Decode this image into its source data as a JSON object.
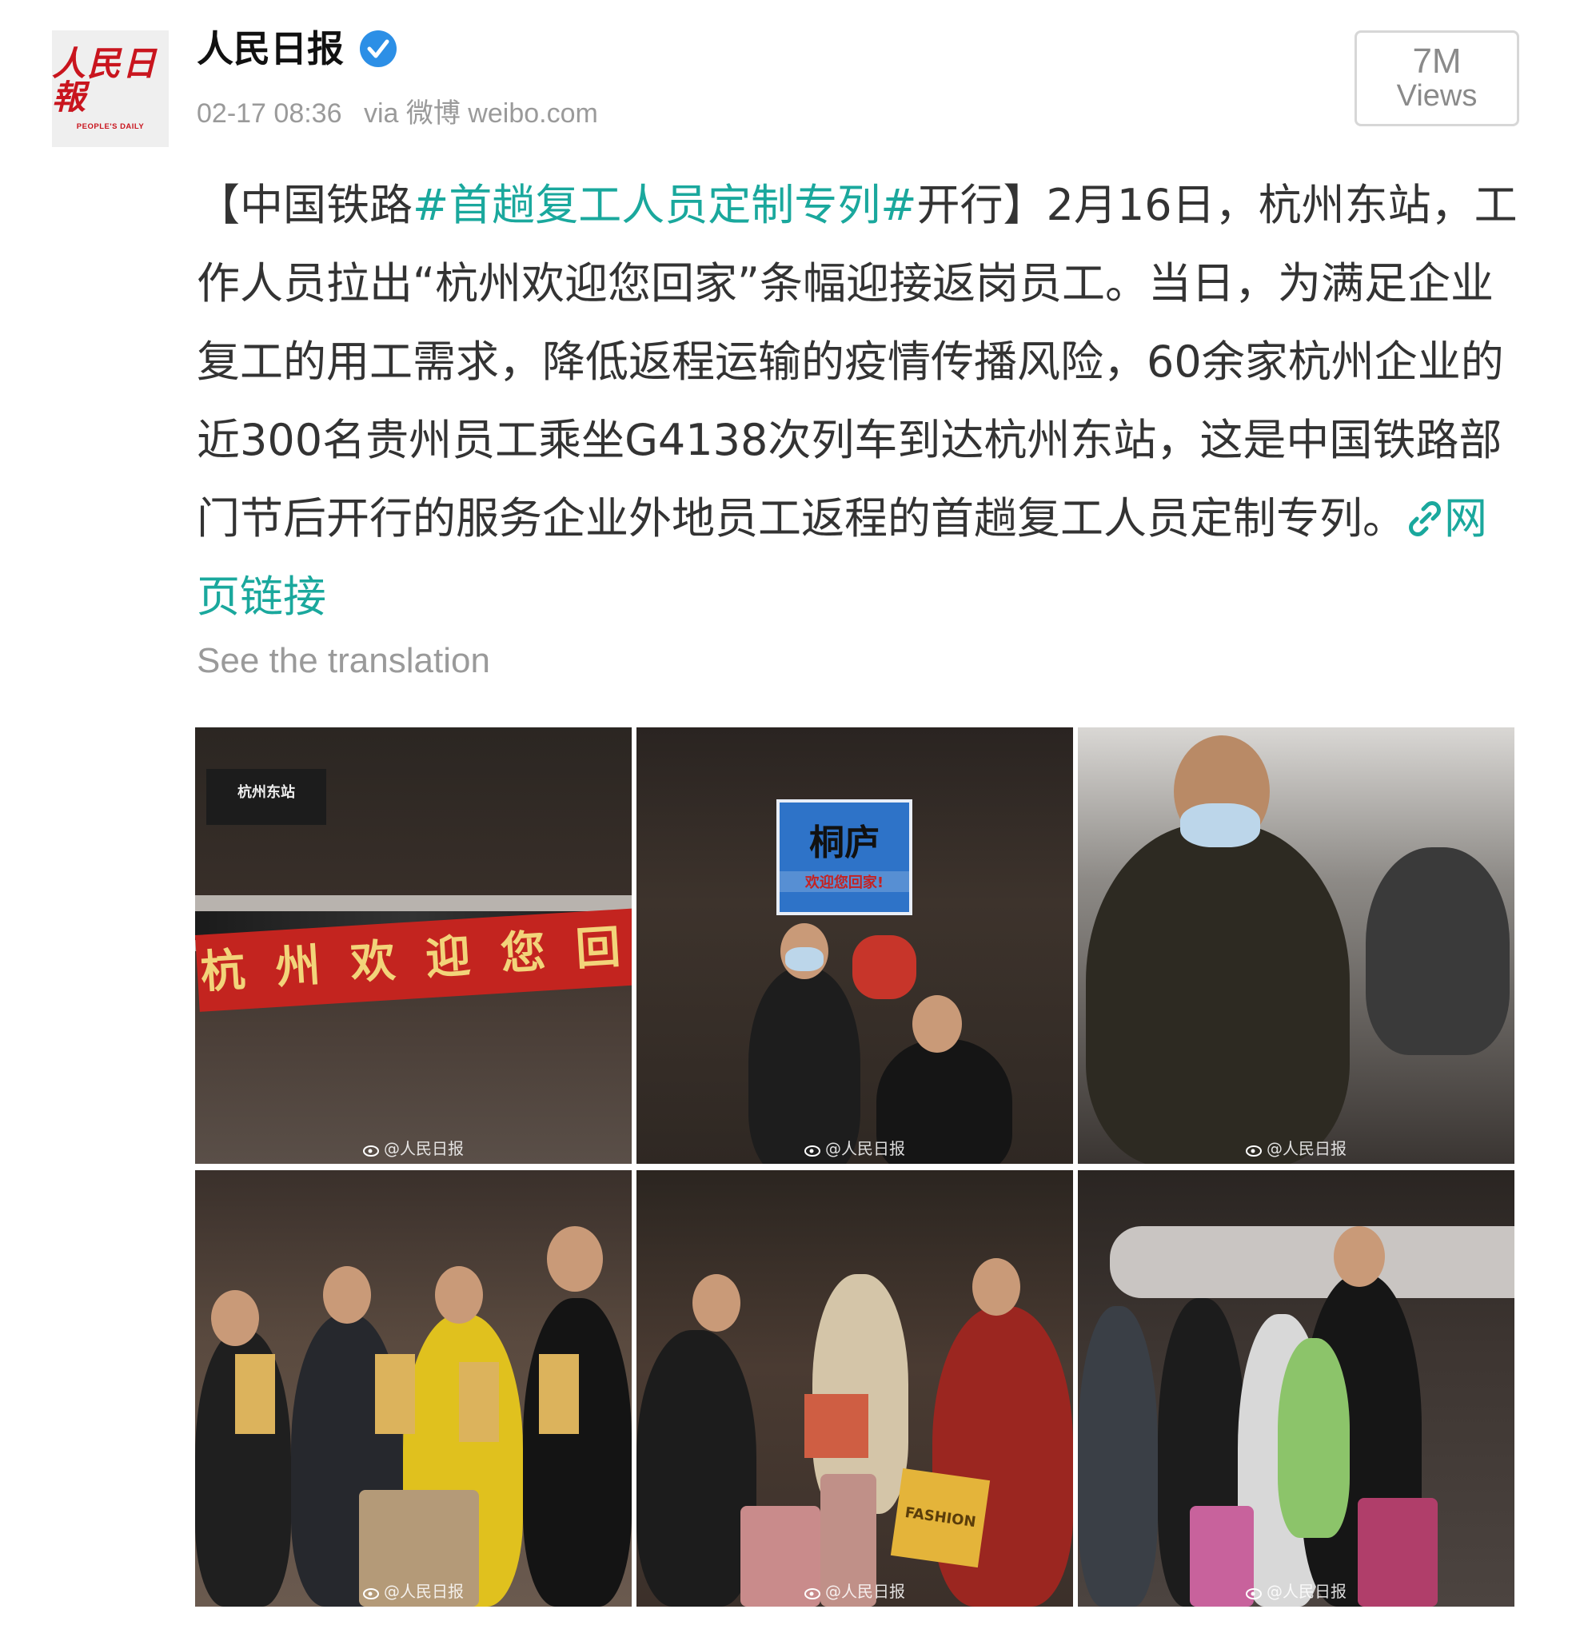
{
  "author": {
    "name": "人民日报",
    "logo_cn": "人民日報",
    "logo_en": "PEOPLE'S DAILY",
    "verified_icon": "verified-badge-icon"
  },
  "meta": {
    "date": "02-17 08:36",
    "via": "via 微博 weibo.com"
  },
  "views": {
    "count": "7M",
    "label": "Views"
  },
  "post": {
    "prefix": "【中国铁路",
    "hashtag": "#首趟复工人员定制专列#",
    "body": "开行】2月16日，杭州东站，工作人员拉出“杭州欢迎您回家”条幅迎接返岗员工。当日，为满足企业复工的用工需求，降低返程运输的疫情传播风险，60余家杭州企业的近300名贵州员工乘坐G4138次列车到达杭州东站，这是中国铁路部门节后开行的服务企业外地员工返程的首趟复工人员定制专列。",
    "link_label": "网页链接",
    "link_icon": "link-icon"
  },
  "translate": "See the translation",
  "photos": {
    "watermark": "@人民日报",
    "banner_text": "杭州欢迎您回家",
    "station_sign": "杭州东站",
    "sign_big": "桐庐",
    "sign_small": "欢迎您回家!",
    "bag_text": "FASHION"
  },
  "colors": {
    "hashtag": "#1aa89d",
    "logo_red": "#c9151e",
    "verified_blue": "#2c8fe6"
  }
}
